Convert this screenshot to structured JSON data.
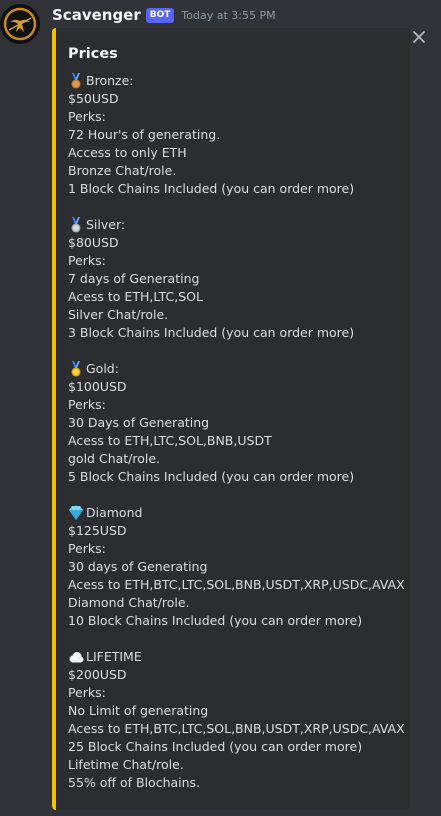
{
  "message": {
    "username": "Scavenger",
    "badge": "BOT",
    "timestamp": "Today at 3:55 PM"
  },
  "embed": {
    "title": "Prices",
    "accent_color": "#f0c20a",
    "tiers": [
      {
        "icon": "bronze-medal-icon",
        "name": "Bronze:",
        "price": "$50USD",
        "perks_label": "Perks:",
        "perks": [
          "72 Hour's of generating.",
          "Access to only ETH",
          "Bronze Chat/role.",
          "1 Block Chains Included (you can order more)"
        ]
      },
      {
        "icon": "silver-medal-icon",
        "name": "Silver:",
        "price": "$80USD",
        "perks_label": "Perks:",
        "perks": [
          "7 days of Generating",
          "Acess to ETH,LTC,SOL",
          "Silver Chat/role.",
          "3 Block Chains Included (you can order more)"
        ]
      },
      {
        "icon": "gold-medal-icon",
        "name": "Gold:",
        "price": "$100USD",
        "perks_label": "Perks:",
        "perks": [
          "30 Days of Generating",
          "Acess to ETH,LTC,SOL,BNB,USDT",
          "gold Chat/role.",
          "5 Block Chains Included (you can order more)"
        ]
      },
      {
        "icon": "diamond-icon",
        "name": "Diamond",
        "price": "$125USD",
        "perks_label": "Perks:",
        "perks": [
          "30 days of Generating",
          "Acess to ETH,BTC,LTC,SOL,BNB,USDT,XRP,USDC,AVAX",
          "Diamond Chat/role.",
          "10 Block Chains Included (you can order more)"
        ]
      },
      {
        "icon": "cloud-icon",
        "name": "LIFETIME",
        "price": "$200USD",
        "perks_label": "Perks:",
        "perks": [
          "No Limit of generating",
          "Acess to ETH,BTC,LTC,SOL,BNB,USDT,XRP,USDC,AVAX",
          "25 Block Chains Included (you can order more)",
          "Lifetime Chat/role.",
          "55% off of Blochains."
        ]
      }
    ]
  }
}
